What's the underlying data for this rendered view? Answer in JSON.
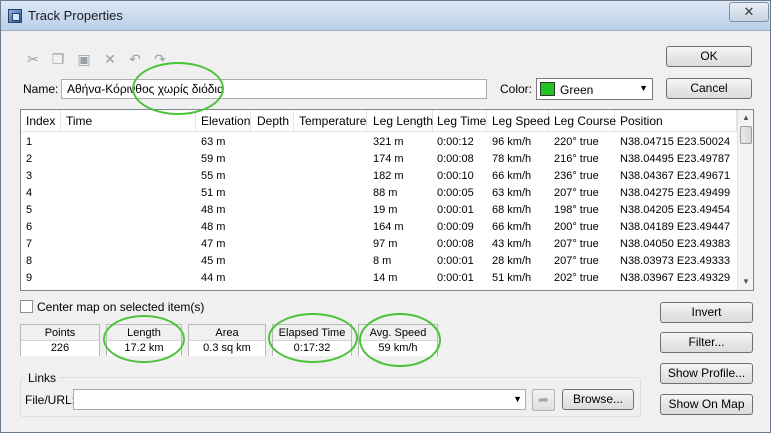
{
  "window": {
    "title": "Track Properties",
    "close_glyph": "✕"
  },
  "toolbar": [
    {
      "icon": "scissors-icon",
      "glyph": "✂"
    },
    {
      "icon": "copy-icon",
      "glyph": "❐"
    },
    {
      "icon": "paste-icon",
      "glyph": "▣"
    },
    {
      "icon": "delete-icon",
      "glyph": "✕"
    },
    {
      "icon": "undo-icon",
      "glyph": "↶"
    },
    {
      "icon": "redo-icon",
      "glyph": "↷"
    }
  ],
  "name_field": {
    "label": "Name:",
    "value": "Αθήνα-Κόρινθος χωρίς διόδια"
  },
  "color_field": {
    "label": "Color:",
    "value": "Green",
    "swatch": "#22c41f"
  },
  "buttons": {
    "ok": "OK",
    "cancel": "Cancel",
    "invert": "Invert",
    "filter": "Filter...",
    "show_profile": "Show Profile...",
    "show_on_map": "Show On Map",
    "browse": "Browse..."
  },
  "table": {
    "columns": [
      "Index",
      "Time",
      "Elevation",
      "Depth",
      "Temperature",
      "Leg Length",
      "Leg Time",
      "Leg Speed",
      "Leg Course",
      "Position"
    ],
    "rows": [
      [
        "1",
        "",
        "63 m",
        "",
        "",
        "321 m",
        "0:00:12",
        "96 km/h",
        "220° true",
        "N38.04715 E23.50024"
      ],
      [
        "2",
        "",
        "59 m",
        "",
        "",
        "174 m",
        "0:00:08",
        "78 km/h",
        "216° true",
        "N38.04495 E23.49787"
      ],
      [
        "3",
        "",
        "55 m",
        "",
        "",
        "182 m",
        "0:00:10",
        "66 km/h",
        "236° true",
        "N38.04367 E23.49671"
      ],
      [
        "4",
        "",
        "51 m",
        "",
        "",
        "88 m",
        "0:00:05",
        "63 km/h",
        "207° true",
        "N38.04275 E23.49499"
      ],
      [
        "5",
        "",
        "48 m",
        "",
        "",
        "19 m",
        "0:00:01",
        "68 km/h",
        "198° true",
        "N38.04205 E23.49454"
      ],
      [
        "6",
        "",
        "48 m",
        "",
        "",
        "164 m",
        "0:00:09",
        "66 km/h",
        "200° true",
        "N38.04189 E23.49447"
      ],
      [
        "7",
        "",
        "47 m",
        "",
        "",
        "97 m",
        "0:00:08",
        "43 km/h",
        "207° true",
        "N38.04050 E23.49383"
      ],
      [
        "8",
        "",
        "45 m",
        "",
        "",
        "8 m",
        "0:00:01",
        "28 km/h",
        "207° true",
        "N38.03973 E23.49333"
      ],
      [
        "9",
        "",
        "44 m",
        "",
        "",
        "14 m",
        "0:00:01",
        "51 km/h",
        "202° true",
        "N38.03967 E23.49329"
      ]
    ]
  },
  "center_map_label": "Center map on selected item(s)",
  "stats": [
    {
      "label": "Points",
      "value": "226"
    },
    {
      "label": "Length",
      "value": "17.2 km"
    },
    {
      "label": "Area",
      "value": "0.3 sq km"
    },
    {
      "label": "Elapsed Time",
      "value": "0:17:32"
    },
    {
      "label": "Avg. Speed",
      "value": "59 km/h"
    }
  ],
  "links": {
    "group_label": "Links",
    "url_label": "File/URL:",
    "url_value": ""
  },
  "highlight_color": "#4cc23a"
}
